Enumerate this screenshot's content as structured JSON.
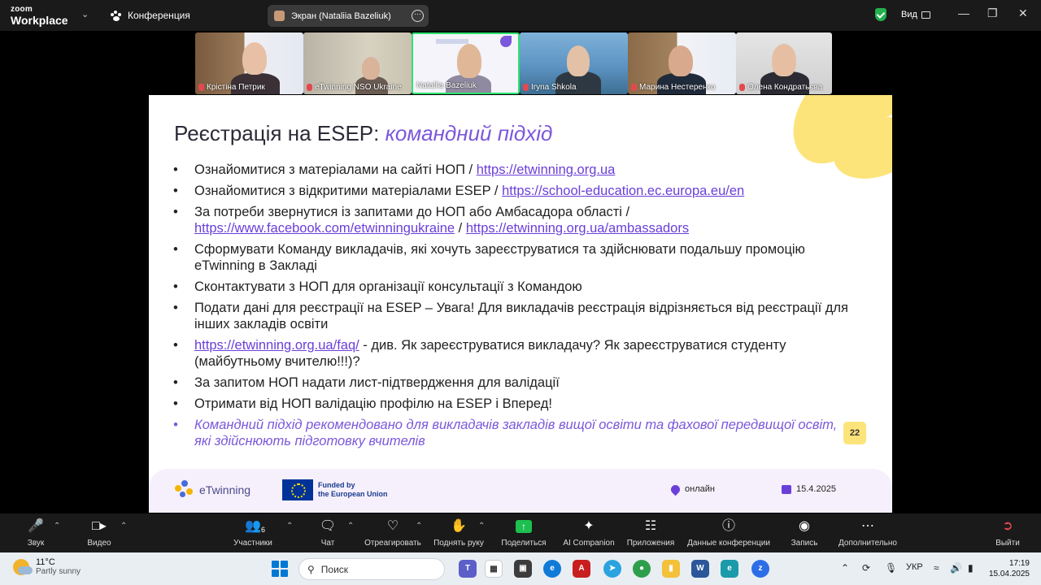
{
  "titlebar": {
    "logo_top": "zoom",
    "logo_bottom": "Workplace",
    "meeting_label": "Конференция",
    "share_label": "Экран (Nataliia Bazeliuk)",
    "view_label": "Вид"
  },
  "participants": [
    {
      "name": "Крістіна Петрик",
      "muted": true
    },
    {
      "name": "eTwinning NSO Ukraine",
      "muted": true
    },
    {
      "name": "Nataliia Bazeliuk",
      "muted": false,
      "active": true
    },
    {
      "name": "Iryna Shkola",
      "muted": true
    },
    {
      "name": "Марина Нестеренко",
      "muted": true
    },
    {
      "name": "Олена  Кондратьєва",
      "muted": true
    }
  ],
  "slide": {
    "title_plain": "Реєстрація на ESEP: ",
    "title_accent": "командний підхід",
    "bullets": [
      {
        "text": "Ознайомитися з матеріалами на сайті НОП / ",
        "link": "https://etwinning.org.ua"
      },
      {
        "text": "Ознайомитися з відкритими  матеріалами ESEP / ",
        "link": "https://school-education.ec.europa.eu/en"
      },
      {
        "text": "За потреби звернутися із запитами до НОП або Амбасадора області / ",
        "link": "https://www.facebook.com/etwinningukraine",
        "sep": " / ",
        "link2": "https://etwinning.org.ua/ambassadors"
      },
      {
        "text": "Сформувати Команду викладачів, які хочуть зареєструватися та здійснювати подальшу промоцію eTwinning в Закладі"
      },
      {
        "text": "Сконтактувати з НОП для організації консультації з Командою"
      },
      {
        "text": "Подати дані для реєстрації на ESEP – Увага! Для викладачів реєстрація відрізняється від реєстрації для інших закладів освіти"
      },
      {
        "link": "https://etwinning.org.ua/faq/",
        "after": " - див. Як зареєструватися викладачу? Як зареєструватися студенту (майбутньому вчителю!!!)?"
      },
      {
        "text": "За запитом НОП надати лист-підтвердження для валідації"
      },
      {
        "text": "Отримати від НОП валідацію профілю на ESEP і Вперед!"
      },
      {
        "text": "Командний підхід рекомендовано для викладачів закладів вищої освіти та фахової передвищої освіт, які здійснюють підготовку вчителів",
        "purple": true
      }
    ],
    "page_number": "22",
    "footer": {
      "etwinning": "eTwinning",
      "eu_line1": "Funded by",
      "eu_line2": "the European Union",
      "location": "онлайн",
      "date": "15.4.2025"
    }
  },
  "toolbar": {
    "audio": "Звук",
    "video": "Видео",
    "participants": "Участники",
    "participants_count": "6",
    "chat": "Чат",
    "react": "Отреагировать",
    "raise_hand": "Поднять руку",
    "share": "Поделиться",
    "ai": "AI Companion",
    "apps": "Приложения",
    "info": "Данные конференции",
    "record": "Запись",
    "more": "Дополнительно",
    "leave": "Выйти"
  },
  "taskbar": {
    "temperature": "11°C",
    "weather": "Partly sunny",
    "search_placeholder": "Поиск",
    "language": "УКР",
    "time": "17:19",
    "date": "15.04.2025"
  },
  "colors": {
    "accent_purple": "#7b57db",
    "link_purple": "#6a3fd9",
    "yellow": "#fde47a",
    "active_green": "#2ee36e",
    "shield_green": "#22b14c"
  }
}
